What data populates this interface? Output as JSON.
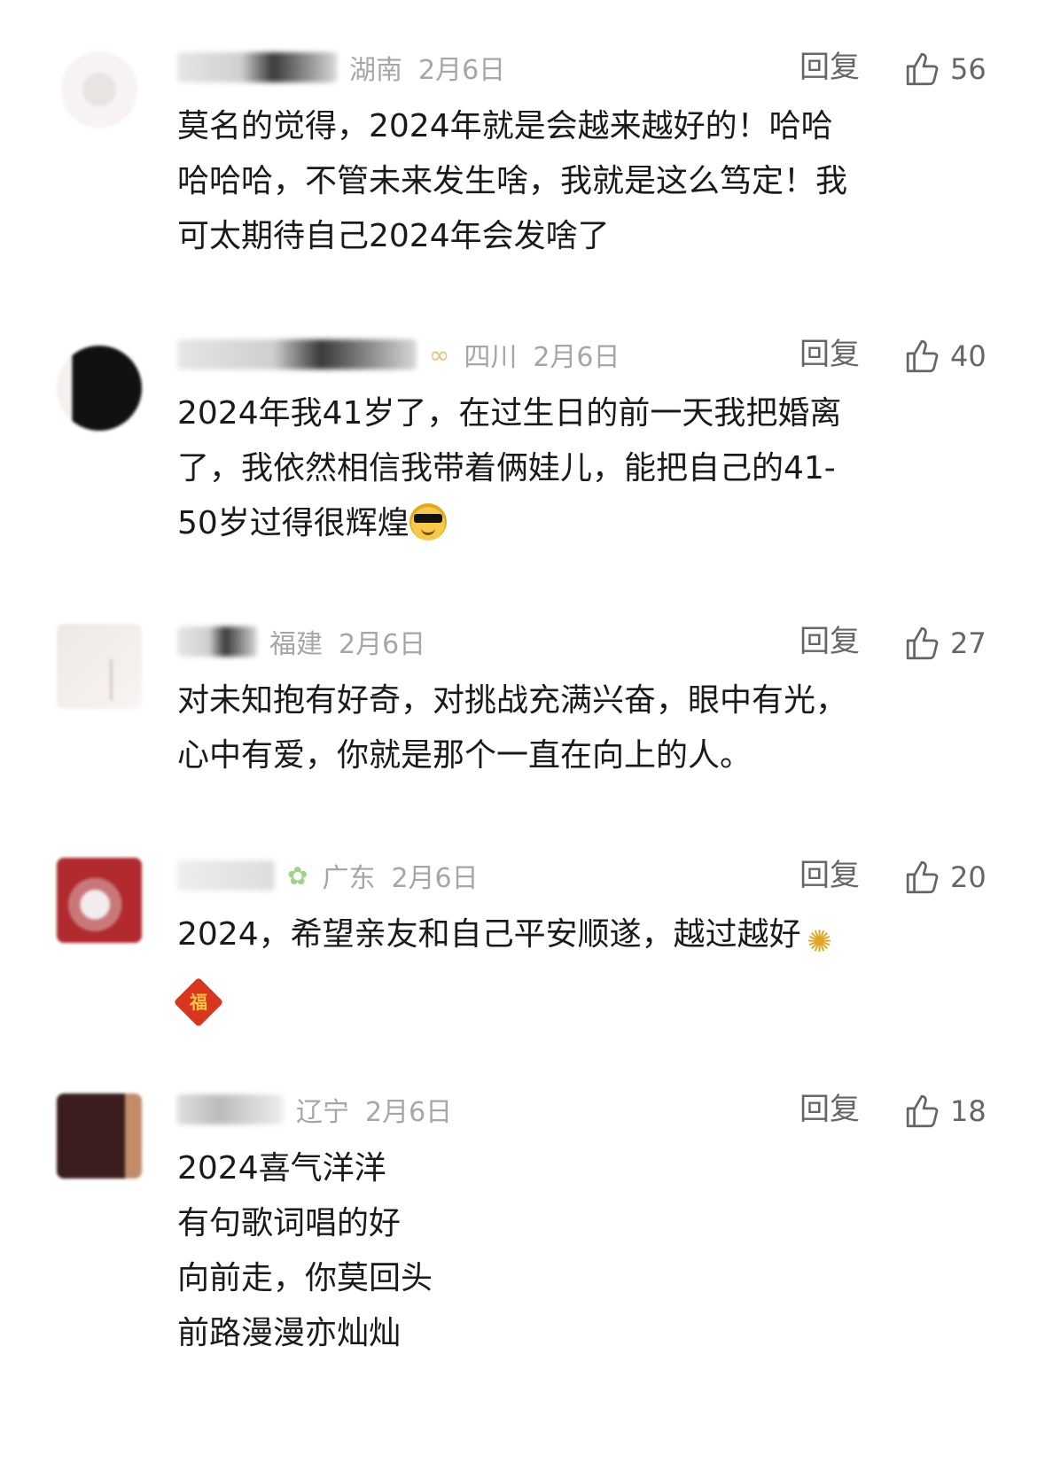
{
  "comments": [
    {
      "location": "湖南",
      "date": "2月6日",
      "reply_label": "回复",
      "likes": "56",
      "lines": [
        "莫名的觉得，2024年就是会越来越好的！哈哈",
        "哈哈哈，不管未来发生啥，我就是这么笃定！我",
        "可太期待自己2024年会发啥了"
      ]
    },
    {
      "location": "四川",
      "date": "2月6日",
      "reply_label": "回复",
      "likes": "40",
      "lines": [
        "2024年我41岁了，在过生日的前一天我把婚离",
        "了，我依然相信我带着俩娃儿，能把自己的41-",
        "50岁过得很辉煌"
      ]
    },
    {
      "location": "福建",
      "date": "2月6日",
      "reply_label": "回复",
      "likes": "27",
      "lines": [
        "对未知抱有好奇，对挑战充满兴奋，眼中有光，",
        "心中有爱，你就是那个一直在向上的人。"
      ]
    },
    {
      "location": "广东",
      "date": "2月6日",
      "reply_label": "回复",
      "likes": "20",
      "lines": [
        "2024，希望亲友和自己平安顺遂，越过越好"
      ]
    },
    {
      "location": "辽宁",
      "date": "2月6日",
      "reply_label": "回复",
      "likes": "18",
      "lines": [
        "2024喜气洋洋",
        "有句歌词唱的好",
        "向前走，你莫回头",
        "前路漫漫亦灿灿"
      ]
    }
  ],
  "icons": {
    "like": "thumbs-up-icon",
    "emoji_2": "sunglasses-emoji",
    "emoji_4a": "fireworks-emoji",
    "emoji_4b": "fu-diamond-emoji"
  },
  "colors": {
    "text": "#1a1a1a",
    "meta": "#a6a6a6",
    "action": "#666666"
  }
}
